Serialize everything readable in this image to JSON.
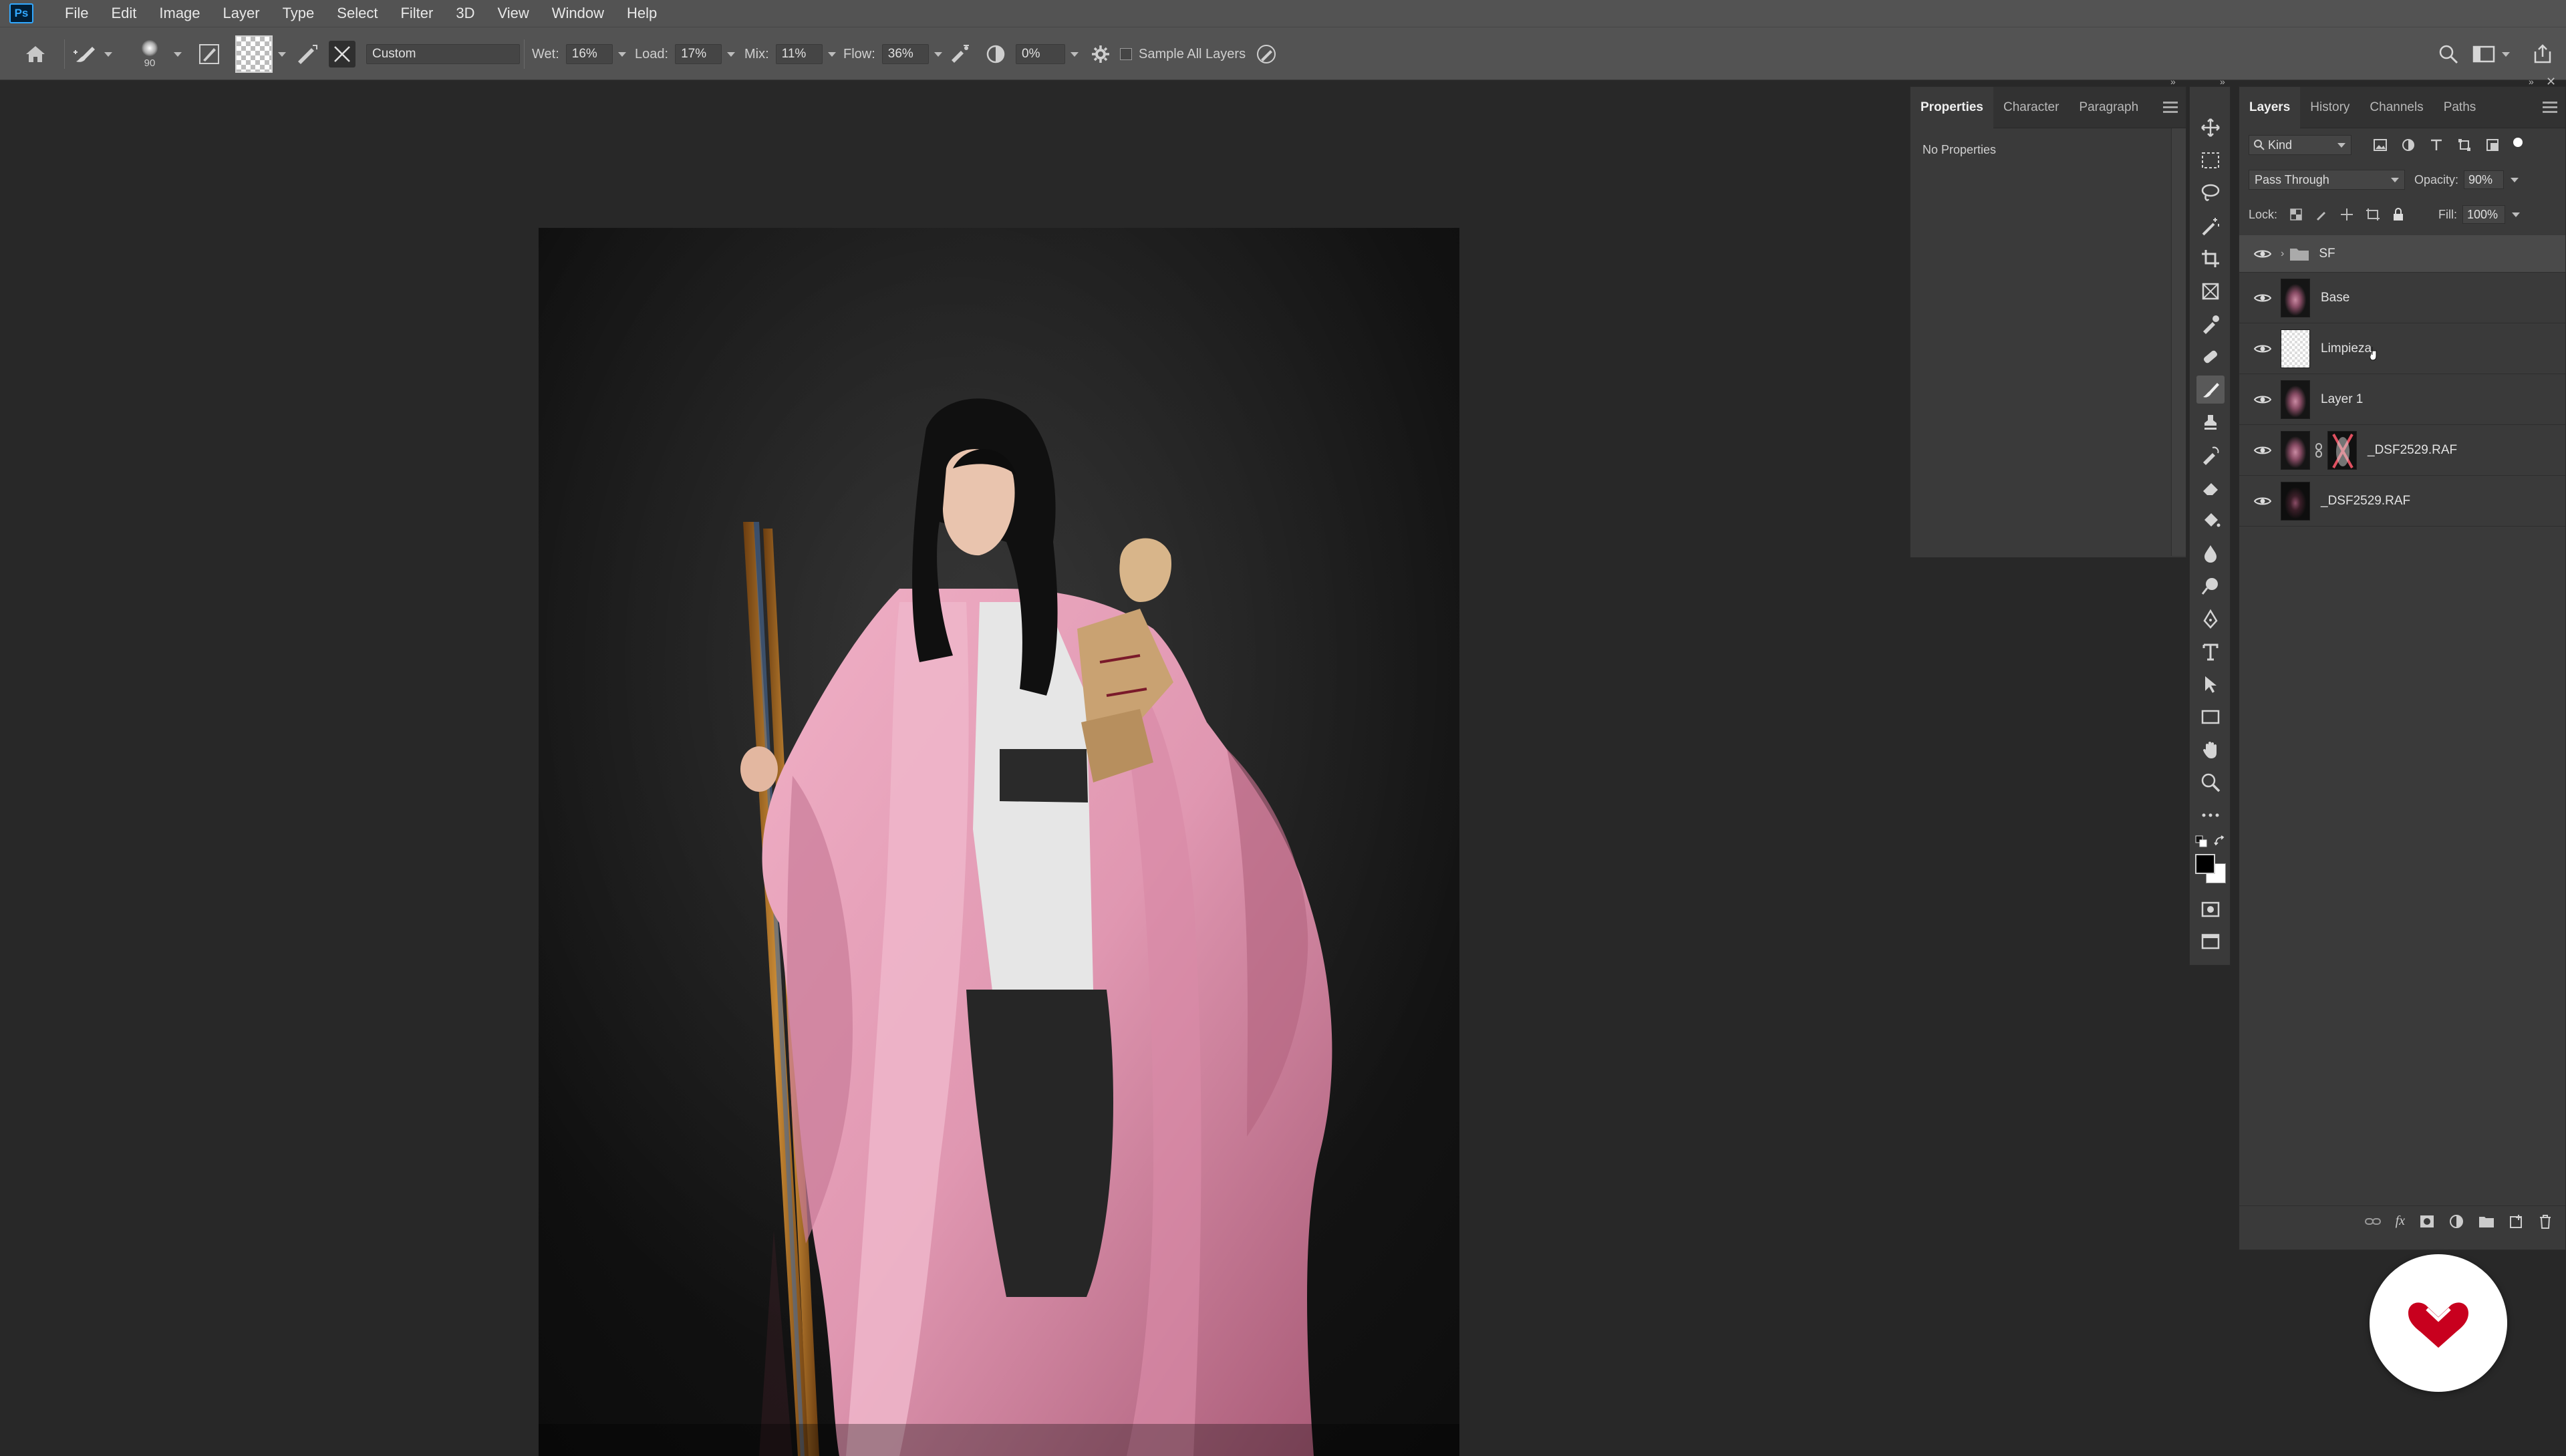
{
  "app": {
    "logo_text": "Ps",
    "accent": "#31a8ff"
  },
  "menubar": {
    "items": [
      "File",
      "Edit",
      "Image",
      "Layer",
      "Type",
      "Select",
      "Filter",
      "3D",
      "View",
      "Window",
      "Help"
    ]
  },
  "options_bar": {
    "brush_size": "90",
    "preset": "Custom",
    "wet": {
      "label": "Wet:",
      "value": "16%"
    },
    "load": {
      "label": "Load:",
      "value": "17%"
    },
    "mix": {
      "label": "Mix:",
      "value": "11%"
    },
    "flow": {
      "label": "Flow:",
      "value": "36%"
    },
    "smoothing": "0%",
    "sample_all_layers": {
      "label": "Sample All Layers",
      "checked": false
    }
  },
  "properties_panel": {
    "tabs": [
      "Properties",
      "Character",
      "Paragraph"
    ],
    "active_tab": "Properties",
    "content": "No Properties"
  },
  "layers_panel": {
    "tabs": [
      "Layers",
      "History",
      "Channels",
      "Paths"
    ],
    "active_tab": "Layers",
    "filter_kind": "Kind",
    "blend_mode": "Pass Through",
    "opacity": {
      "label": "Opacity:",
      "value": "90%"
    },
    "lock_label": "Lock:",
    "fill": {
      "label": "Fill:",
      "value": "100%"
    },
    "layers": [
      {
        "name": "SF",
        "type": "group",
        "visible": true,
        "selected": true
      },
      {
        "name": "Base",
        "type": "image",
        "visible": true
      },
      {
        "name": "Limpieza",
        "type": "empty",
        "visible": true
      },
      {
        "name": "Layer 1",
        "type": "image",
        "visible": true
      },
      {
        "name": "_DSF2529.RAF",
        "type": "image-with-mask",
        "visible": true
      },
      {
        "name": "_DSF2529.RAF",
        "type": "image",
        "visible": true
      }
    ]
  },
  "colors": {
    "foreground": "#000000",
    "background": "#ffffff",
    "logo_red": "#c8001e",
    "kimono_pink": "#e8a0b8"
  }
}
